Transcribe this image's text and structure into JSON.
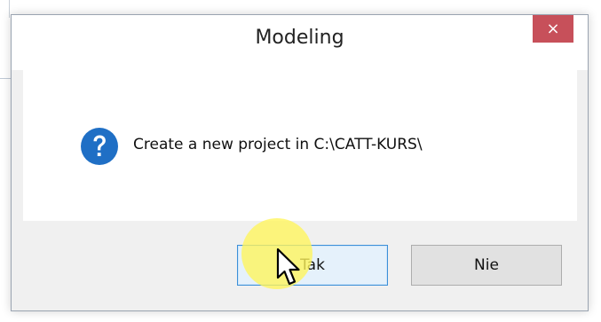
{
  "dialog": {
    "title": "Modeling",
    "close_symbol": "×",
    "message": "Create a new project in C:\\CATT-KURS\\",
    "icon": "question-icon",
    "buttons": {
      "yes_label": "Tak",
      "no_label": "Nie"
    }
  },
  "colors": {
    "close_button": "#c7505a",
    "question_icon": "#1f6fc5",
    "focused_button_border": "#3c8fd8",
    "cursor_highlight": "#fff55a"
  }
}
